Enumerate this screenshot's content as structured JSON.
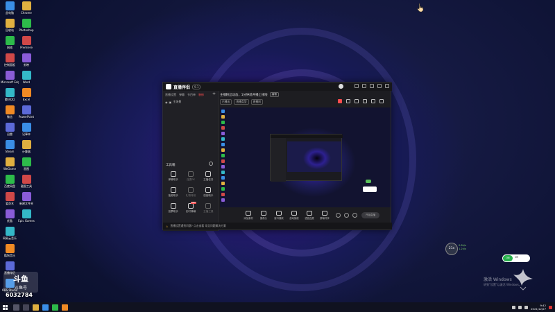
{
  "app": {
    "title": "直播伴侣",
    "version_badge": "9.1",
    "left_tabs": [
      "直播设置",
      "弹幕",
      "节目单",
      "装修"
    ],
    "active_tab_index": 3,
    "scene_label": "主场景",
    "tools_header": "工具箱",
    "tools": [
      {
        "name": "tool-1",
        "label": "弹幕助手",
        "dim": false
      },
      {
        "name": "tool-2",
        "label": "连麦PK",
        "dim": true
      },
      {
        "name": "tool-3",
        "label": "主播任务",
        "dim": false
      },
      {
        "name": "tool-4",
        "label": "抽奖助手",
        "dim": false
      },
      {
        "name": "tool-5",
        "label": "礼物特效",
        "dim": true
      },
      {
        "name": "tool-6",
        "label": "语音助手",
        "dim": false
      },
      {
        "name": "tool-7",
        "label": "投票助手",
        "dim": false
      },
      {
        "name": "tool-8",
        "label": "实时弹幕",
        "dim": false,
        "badge": "NEW"
      },
      {
        "name": "tool-9",
        "label": "主播工具",
        "dim": true
      }
    ],
    "notice": "直播设置遇到问题? 点击查看 常见问题解决方案",
    "room_title": "主播粉丝动态，1分钟前开播上线啦",
    "edit_label": "编辑",
    "room_meta": [
      "已播出",
      "直播类型",
      "直播间"
    ],
    "bottom_tools": [
      "添加素材",
      "摄像头",
      "窗口捕获",
      "游戏捕获",
      "语音连麦",
      "屏幕共享"
    ],
    "go_live": "开始直播"
  },
  "widgets": {
    "speed_value": "21x",
    "speed_up": "0.8k/s",
    "speed_down": "1.2k/s",
    "vm_label": "VM",
    "activate_line1": "激活 Windows",
    "activate_line2": "转到\"设置\"以激活 Windows。"
  },
  "watermark": {
    "brand": "斗鱼",
    "sub": "斗鱼号",
    "room_id": "6032784"
  },
  "taskbar": {
    "time": "9:42",
    "date": "2021/12/27"
  },
  "desktop": {
    "icons": [
      "此电脑",
      "回收站",
      "网络",
      "控制面板",
      "Microsoft Edge",
      "腾讯QQ",
      "微信",
      "迅雷",
      "Steam",
      "WeGame",
      "百度网盘",
      "爱奇艺",
      "优酷",
      "网易云音乐",
      "酷狗音乐",
      "直播伴侣",
      "OBS Studio",
      "Chrome",
      "Photoshop",
      "Premiere",
      "剪映",
      "Word",
      "Excel",
      "PowerPoint",
      "记事本",
      "计算器",
      "画图",
      "截图工具",
      "新建文件夹",
      "Epic Games"
    ]
  }
}
